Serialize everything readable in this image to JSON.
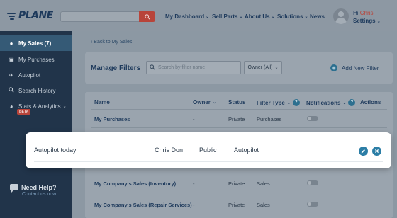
{
  "header": {
    "logo_text": "PLANE",
    "search_placeholder": "",
    "nav": [
      {
        "label": "My Dashboard",
        "has_caret": true
      },
      {
        "label": "Sell Parts",
        "has_caret": true
      },
      {
        "label": "About Us",
        "has_caret": true
      },
      {
        "label": "Solutions",
        "has_caret": true
      },
      {
        "label": "News",
        "has_caret": false
      }
    ],
    "greeting_prefix": "Hi ",
    "user_name": "Chris!",
    "settings_label": "Settings"
  },
  "sidebar": {
    "items": [
      {
        "label": "My Sales (7)",
        "icon": "money-bag-icon",
        "active": true
      },
      {
        "label": "My Purchases",
        "icon": "cart-icon",
        "active": false
      },
      {
        "label": "Autopilot",
        "icon": "plane-icon",
        "active": false
      },
      {
        "label": "Search History",
        "icon": "search-icon",
        "active": false
      },
      {
        "label": "Stats & Analytics",
        "icon": "pie-chart-icon",
        "active": false
      }
    ],
    "beta_badge": "BETA",
    "help_title": "Need Help?",
    "help_link": "Contact us now."
  },
  "main": {
    "back_link": "‹ Back to My Sales",
    "title": "Manage Filters",
    "filter_search_placeholder": "Search by filter name",
    "owner_select": "Owner (All)",
    "add_filter_label": "Add New Filter",
    "columns": {
      "name": "Name",
      "owner": "Owner",
      "status": "Status",
      "filter_type": "Filter Type",
      "notifications": "Notifications",
      "actions": "Actions"
    },
    "rows": [
      {
        "name": "My Purchases",
        "owner": "-",
        "status": "Private",
        "type": "Purchases"
      },
      {
        "name": "My Company's Sales (Inventory)",
        "owner": "-",
        "status": "Private",
        "type": "Sales"
      },
      {
        "name": "My Company's Sales (Repair Services)",
        "owner": "-",
        "status": "Private",
        "type": "Sales"
      }
    ],
    "highlight_row": {
      "name": "Autopilot today",
      "owner": "Chris Don",
      "status": "Public",
      "type": "Autopilot"
    }
  },
  "colors": {
    "brand_navy": "#1e3a5c",
    "accent_red": "#b8443a",
    "accent_blue": "#2c7ea6"
  }
}
